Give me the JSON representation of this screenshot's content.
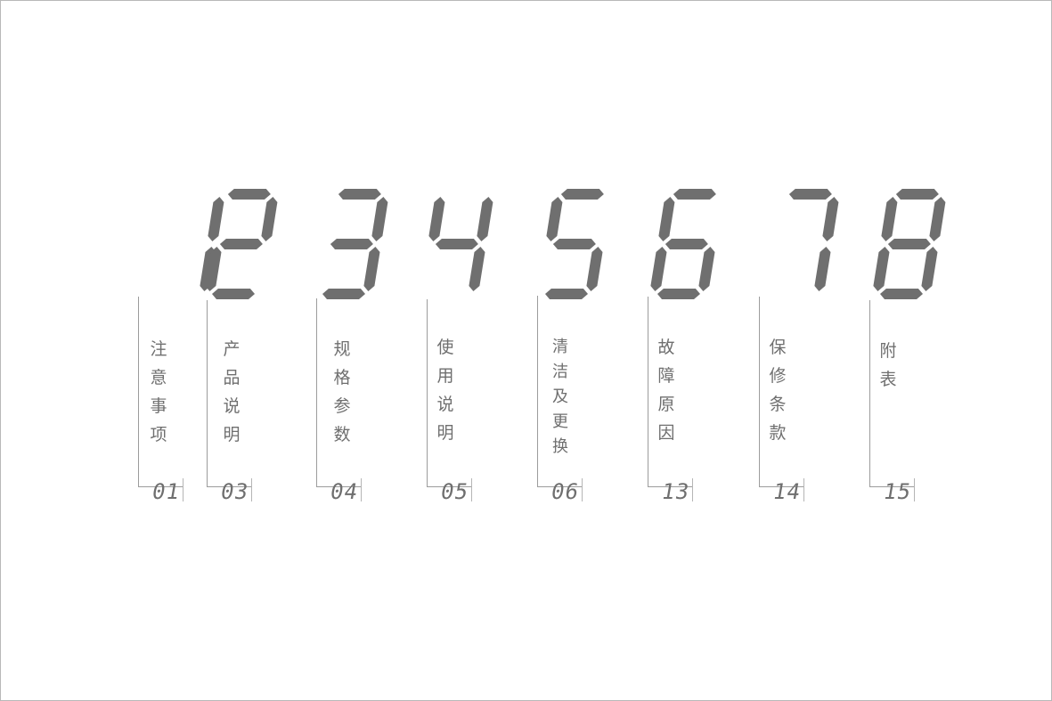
{
  "digits": [
    "1",
    "2",
    "3",
    "4",
    "5",
    "6",
    "7",
    "8"
  ],
  "sections": [
    {
      "number": "1",
      "chars": [
        "注",
        "意",
        "事",
        "项"
      ],
      "page": "01"
    },
    {
      "number": "2",
      "chars": [
        "产",
        "品",
        "说",
        "明"
      ],
      "page": "03"
    },
    {
      "number": "3",
      "chars": [
        "规",
        "格",
        "参",
        "数"
      ],
      "page": "04"
    },
    {
      "number": "4",
      "chars": [
        "使",
        "用",
        "说",
        "明"
      ],
      "page": "05"
    },
    {
      "number": "5",
      "chars": [
        "清",
        "洁",
        "及",
        "更",
        "换"
      ],
      "page": "06"
    },
    {
      "number": "6",
      "chars": [
        "故",
        "障",
        "原",
        "因"
      ],
      "page": "13"
    },
    {
      "number": "7",
      "chars": [
        "保",
        "修",
        "条",
        "款"
      ],
      "page": "14"
    },
    {
      "number": "8",
      "chars": [
        "附",
        "表"
      ],
      "page": "15"
    }
  ],
  "colors": {
    "segment": "#6f6f6f",
    "rule": "#9c9c9c",
    "text": "#6f6f6f"
  }
}
